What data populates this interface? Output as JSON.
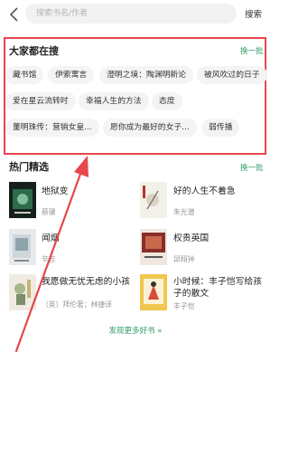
{
  "search": {
    "placeholder": "搜索书名/作者",
    "button": "搜索"
  },
  "hot_search": {
    "title": "大家都在搜",
    "swap": "换一批",
    "tags": [
      "藏书馆",
      "伊索寓言",
      "澄明之境：陶渊明新论",
      "被风吹过的日子",
      "爱在星云流转时",
      "幸福人生的方法",
      "态度",
      "董明珠传：营销女皇...",
      "愿你成为最好的女子...",
      "弱传播"
    ]
  },
  "featured": {
    "title": "热门精选",
    "swap": "换一批",
    "books": [
      {
        "title": "地狱变",
        "author": "蔡骥"
      },
      {
        "title": "好的人生不着急",
        "author": "朱光潜"
      },
      {
        "title": "闻烟",
        "author": "辛苦"
      },
      {
        "title": "权贵英国",
        "author": "邱翔钟"
      },
      {
        "title": "我愿做无忧无虑的小孩",
        "author": "（英）拜伦著；林捷译"
      },
      {
        "title": "小时候：丰子恺写给孩子的散文",
        "author": "丰子恺"
      }
    ],
    "more": "发现更多好书 »"
  },
  "colors": {
    "accent_green": "#2e9c63",
    "highlight_red": "#e5474c"
  }
}
